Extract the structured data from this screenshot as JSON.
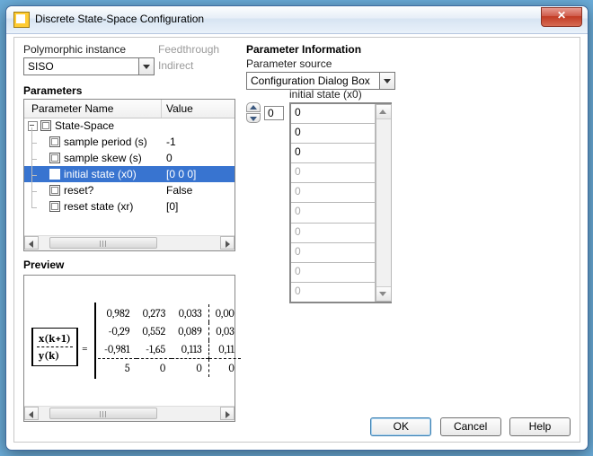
{
  "window": {
    "title": "Discrete State-Space Configuration"
  },
  "left": {
    "poly_label": "Polymorphic instance",
    "poly_value": "SISO",
    "feed_label": "Feedthrough",
    "feed_value": "Indirect",
    "params_header": "Parameters",
    "col_name": "Parameter Name",
    "col_value": "Value",
    "rows": [
      {
        "name": "State-Space",
        "value": ""
      },
      {
        "name": "sample period (s)",
        "value": "-1"
      },
      {
        "name": "sample skew (s)",
        "value": "0"
      },
      {
        "name": "initial state (x0)",
        "value": "[0 0 0]"
      },
      {
        "name": "reset?",
        "value": "False"
      },
      {
        "name": "reset state (xr)",
        "value": "[0]"
      }
    ],
    "preview_header": "Preview",
    "preview": {
      "lhs_top": "x(k+1)",
      "lhs_bot": "y(k)",
      "eq": "=",
      "matrix": [
        [
          "0,982",
          "0,273",
          "0,033",
          "0,00"
        ],
        [
          "-0,29",
          "0,552",
          "0,089",
          "0,03"
        ],
        [
          "-0,981",
          "-1,65",
          "0,113",
          "0,11"
        ],
        [
          "5",
          "0",
          "0",
          "0"
        ]
      ]
    }
  },
  "right": {
    "header": "Parameter Information",
    "src_label": "Parameter source",
    "src_value": "Configuration Dialog Box",
    "array_label": "initial state (x0)",
    "spin_value": "0",
    "cells": [
      "0",
      "0",
      "0",
      "0",
      "0",
      "0",
      "0",
      "0",
      "0",
      "0"
    ],
    "enabled_count": 3
  },
  "buttons": {
    "ok": "OK",
    "cancel": "Cancel",
    "help": "Help"
  }
}
